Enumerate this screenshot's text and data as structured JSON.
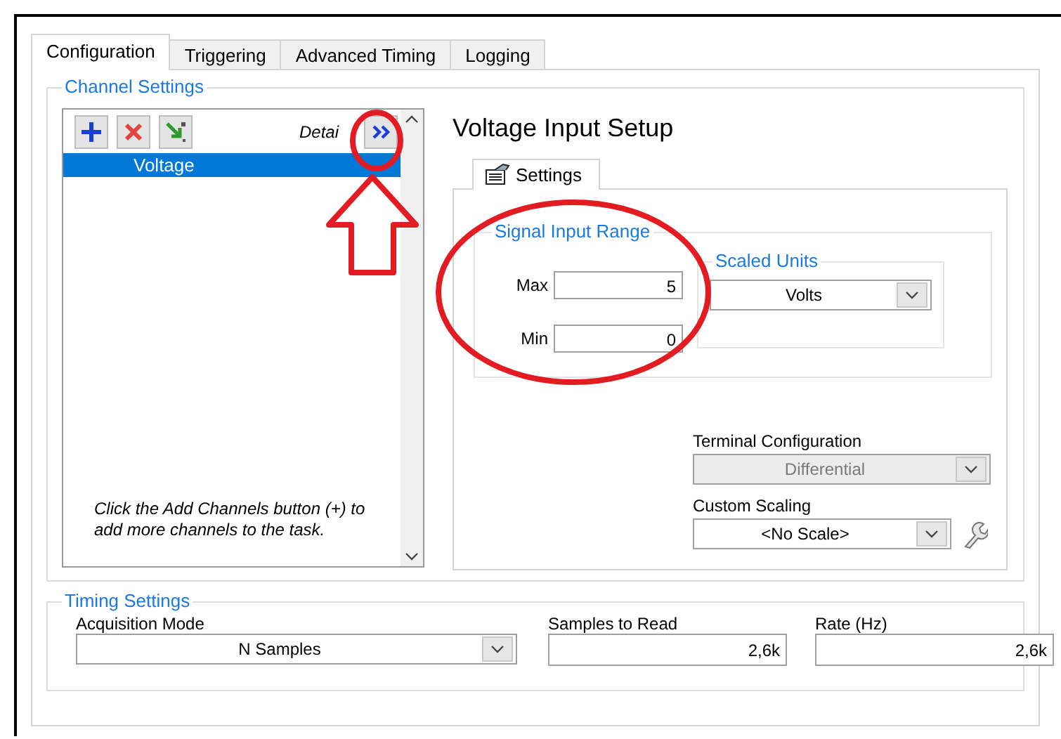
{
  "tabs": [
    {
      "label": "Configuration",
      "selected": true
    },
    {
      "label": "Triggering",
      "selected": false
    },
    {
      "label": "Advanced Timing",
      "selected": false
    },
    {
      "label": "Logging",
      "selected": false
    }
  ],
  "channel_settings": {
    "title": "Channel Settings",
    "details_label": "Detai",
    "channels": [
      {
        "name": "Voltage",
        "selected": true
      }
    ],
    "hint": "Click the Add Channels button (+) to add more channels to the task."
  },
  "setup": {
    "title": "Voltage Input Setup",
    "tabs": [
      {
        "label": "Settings",
        "selected": true
      }
    ],
    "signal_input_range": {
      "title": "Signal Input Range",
      "max_label": "Max",
      "max": "5",
      "min_label": "Min",
      "min": "0"
    },
    "scaled_units": {
      "title": "Scaled Units",
      "value": "Volts"
    },
    "terminal_configuration": {
      "label": "Terminal Configuration",
      "value": "Differential",
      "disabled": true
    },
    "custom_scaling": {
      "label": "Custom Scaling",
      "value": "<No Scale>",
      "disabled": false
    }
  },
  "timing_settings": {
    "title": "Timing Settings",
    "acquisition_mode": {
      "label": "Acquisition Mode",
      "value": "N Samples"
    },
    "samples_to_read": {
      "label": "Samples to Read",
      "value": "2,6k"
    },
    "rate": {
      "label": "Rate (Hz)",
      "value": "2,6k"
    }
  },
  "annotations": [
    {
      "kind": "circle"
    },
    {
      "kind": "arrow"
    },
    {
      "kind": "circle"
    }
  ]
}
